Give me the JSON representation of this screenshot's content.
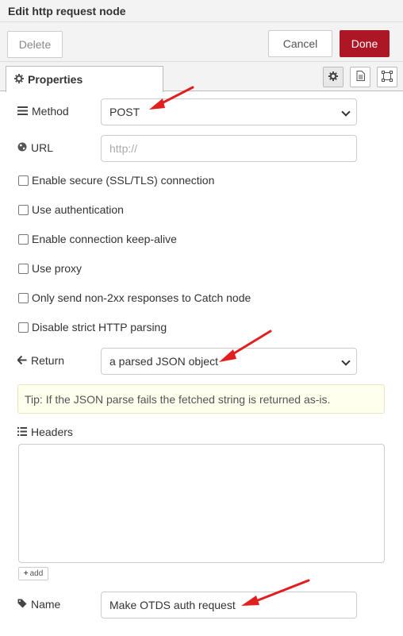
{
  "window": {
    "title": "Edit http request node"
  },
  "toolbar": {
    "delete_label": "Delete",
    "cancel_label": "Cancel",
    "done_label": "Done"
  },
  "tabs": {
    "properties_label": "Properties"
  },
  "icons": {
    "tab_settings": "gear-icon",
    "tab_description": "document-icon",
    "tab_appearance": "frame-icon",
    "method": "list-icon",
    "url": "globe-icon",
    "return": "arrow-left-icon",
    "headers": "list-icon",
    "name": "tag-icon",
    "annotation": "red-arrow"
  },
  "colors": {
    "done_button": "#ad1625",
    "annotation_arrow": "#e11f1f",
    "tip_background": "#ffffee"
  },
  "form": {
    "method": {
      "label": "Method",
      "value": "POST"
    },
    "url": {
      "label": "URL",
      "value": "",
      "placeholder": "http://"
    },
    "checkboxes": [
      {
        "label": "Enable secure (SSL/TLS) connection",
        "checked": false
      },
      {
        "label": "Use authentication",
        "checked": false
      },
      {
        "label": "Enable connection keep-alive",
        "checked": false
      },
      {
        "label": "Use proxy",
        "checked": false
      },
      {
        "label": "Only send non-2xx responses to Catch node",
        "checked": false
      },
      {
        "label": "Disable strict HTTP parsing",
        "checked": false
      }
    ],
    "return": {
      "label": "Return",
      "value": "a parsed JSON object"
    },
    "tip": "Tip: If the JSON parse fails the fetched string is returned as-is.",
    "headers": {
      "label": "Headers",
      "add_label": "add"
    },
    "name": {
      "label": "Name",
      "value": "Make OTDS auth request"
    }
  }
}
